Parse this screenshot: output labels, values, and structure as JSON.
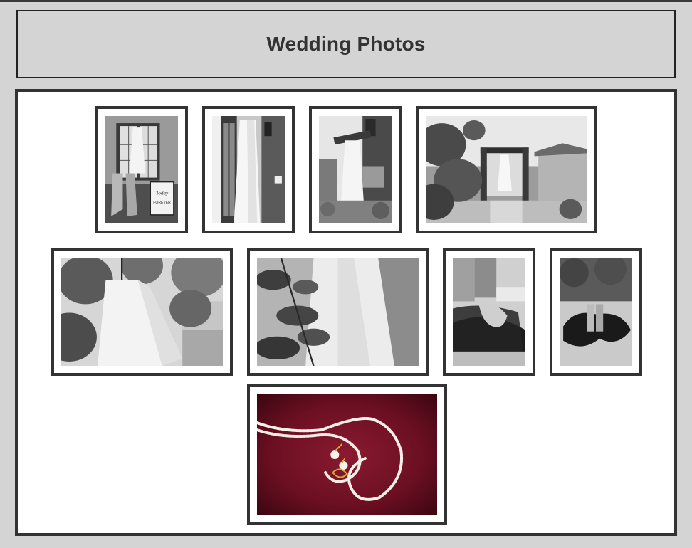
{
  "header": {
    "title": "Wedding Photos"
  },
  "gallery": {
    "photos": [
      {
        "name": "dress-with-boots-doorway",
        "tone": "bw"
      },
      {
        "name": "dress-hanging-on-door",
        "tone": "bw"
      },
      {
        "name": "dress-hanging-lantern-post",
        "tone": "bw"
      },
      {
        "name": "dress-hanging-in-gateway",
        "tone": "bw"
      },
      {
        "name": "dress-hanging-in-tree",
        "tone": "bw"
      },
      {
        "name": "dress-closeup-leaves",
        "tone": "bw"
      },
      {
        "name": "boots-on-fur-rug-closeup",
        "tone": "bw"
      },
      {
        "name": "boots-on-fur-rug",
        "tone": "bw"
      },
      {
        "name": "pearl-necklace-on-red-fur",
        "tone": "color"
      }
    ]
  },
  "colors": {
    "page_background": "#d4d4d4",
    "gallery_background": "#ffffff",
    "frame_border": "#333333",
    "title_text": "#333333",
    "fur_red": "#6b0f22"
  },
  "sign_text": {
    "line1": "Today",
    "line2": "FOREVER"
  }
}
